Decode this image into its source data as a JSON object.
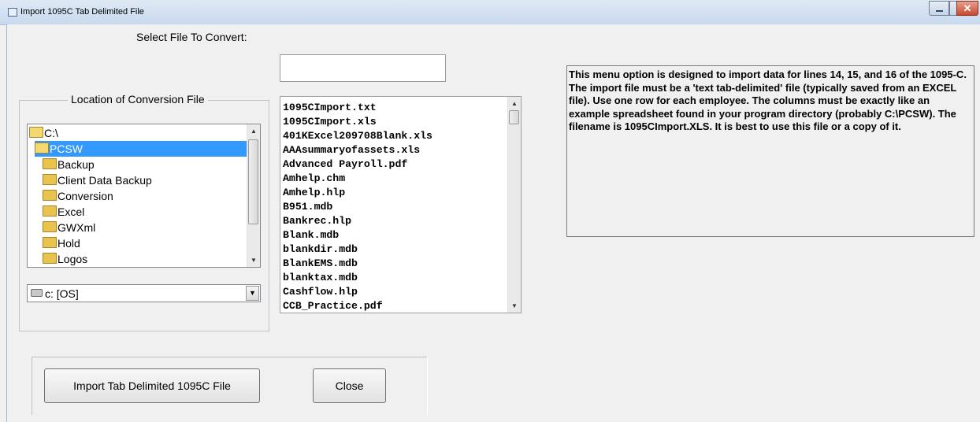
{
  "window": {
    "title": "Import 1095C Tab Delimited File",
    "controls": {
      "minimize": "—",
      "maximize": "□",
      "close": "✕"
    }
  },
  "select_file": {
    "label": "Select File To Convert:",
    "value": ""
  },
  "location_group": {
    "legend": "Location of Conversion File",
    "directories": [
      {
        "label": "C:\\",
        "icon": "folder-open-icon",
        "selected": false
      },
      {
        "label": "PCSW",
        "icon": "folder-open-icon",
        "selected": true
      },
      {
        "label": "Backup",
        "icon": "folder-icon",
        "selected": false
      },
      {
        "label": "Client Data Backup",
        "icon": "folder-icon",
        "selected": false
      },
      {
        "label": "Conversion",
        "icon": "folder-icon",
        "selected": false
      },
      {
        "label": "Excel",
        "icon": "folder-icon",
        "selected": false
      },
      {
        "label": "GWXml",
        "icon": "folder-icon",
        "selected": false
      },
      {
        "label": "Hold",
        "icon": "folder-icon",
        "selected": false
      },
      {
        "label": "Logos",
        "icon": "folder-icon",
        "selected": false
      }
    ],
    "drive": "c: [OS]"
  },
  "files": [
    "1095CImport.txt",
    "1095CImport.xls",
    "401KExcel209708Blank.xls",
    "AAAsummaryofassets.xls",
    "Advanced Payroll.pdf",
    "Amhelp.chm",
    "Amhelp.hlp",
    "B951.mdb",
    "Bankrec.hlp",
    "Blank.mdb",
    "blankdir.mdb",
    "BlankEMS.mdb",
    "blanktax.mdb",
    "Cashflow.hlp",
    "CCB_Practice.pdf"
  ],
  "info": {
    "text": "This menu option is designed to import data for lines 14, 15, and 16 of the 1095-C.  The import file must be a 'text tab-delimited' file (typically saved from an EXCEL file).  Use one row for each employee.  The columns must be exactly like an example spreadsheet found in your program directory (probably C:\\PCSW).  The filename is 1095CImport.XLS.  It is best to use this file or a copy of it."
  },
  "buttons": {
    "import": "Import Tab Delimited 1095C File",
    "close": "Close"
  },
  "colors": {
    "selection": "#3399ff",
    "dialog_bg": "#f0f0f0"
  }
}
